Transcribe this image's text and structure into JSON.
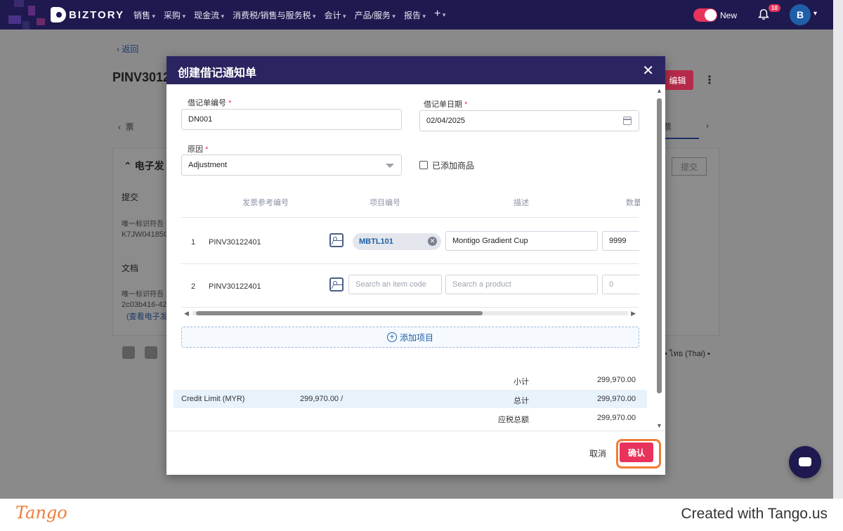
{
  "app": {
    "brand": "BIZTORY",
    "menu": [
      "销售",
      "采购",
      "现金流",
      "消费税/销售与服务税",
      "会计",
      "产品/服务",
      "报告"
    ],
    "menu_plus": "+",
    "toggle_label": "New",
    "notification_count": "10",
    "avatar_initial": "B"
  },
  "background_page": {
    "back_label": "返回",
    "doc_title": "PINV3012",
    "edit_label": "编辑",
    "tab_left": "票",
    "tab_right": "票",
    "card_title": "电子发",
    "submit_label": "提交",
    "section_submit": "提交",
    "uid_label_1": "唯一标识符吾",
    "uid_value_1": "K7JW04185C",
    "section_docs": "文档",
    "uid_label_2": "唯一标识符吾",
    "uid_value_2": "2c03b416-42",
    "view_link": "(查看电子发",
    "lang_text": "• ไทย (Thai) •"
  },
  "modal": {
    "title": "创建借记通知单",
    "close_icon": "close-icon",
    "debit_no_label": "借记单编号",
    "debit_no_value": "DN001",
    "debit_date_label": "借记单日期",
    "debit_date_value": "02/04/2025",
    "reason_label": "原因",
    "reason_value": "Adjustment",
    "added_items_label": "已添加商品",
    "required_mark": "*",
    "columns": [
      "发票参考编号",
      "项目编号",
      "描述",
      "数量"
    ],
    "rows": [
      {
        "num": "1",
        "ref": "PINV30122401",
        "item_code": "MBTL101",
        "description": "Montigo Gradient Cup",
        "qty": "9999"
      },
      {
        "num": "2",
        "ref": "PINV30122401",
        "item_code_placeholder": "Search an item code",
        "description_placeholder": "Search a product",
        "qty": "0"
      }
    ],
    "add_item_label": "添加项目",
    "totals": {
      "subtotal_label": "小计",
      "subtotal_value": "299,970.00",
      "credit_limit_label": "Credit Limit (MYR)",
      "credit_limit_value": "299,970.00 /",
      "total_label": "总计",
      "total_value": "299,970.00",
      "taxable_label": "应税总额",
      "taxable_value": "299,970.00"
    },
    "cancel_label": "取消",
    "confirm_label": "确认"
  },
  "footer": {
    "tango_logo": "Tango",
    "credit": "Created with Tango.us"
  },
  "colors": {
    "nav_bg": "#1e1a4f",
    "modal_header": "#2a2560",
    "accent": "#e8335c",
    "highlight_ring": "#f07c38"
  }
}
